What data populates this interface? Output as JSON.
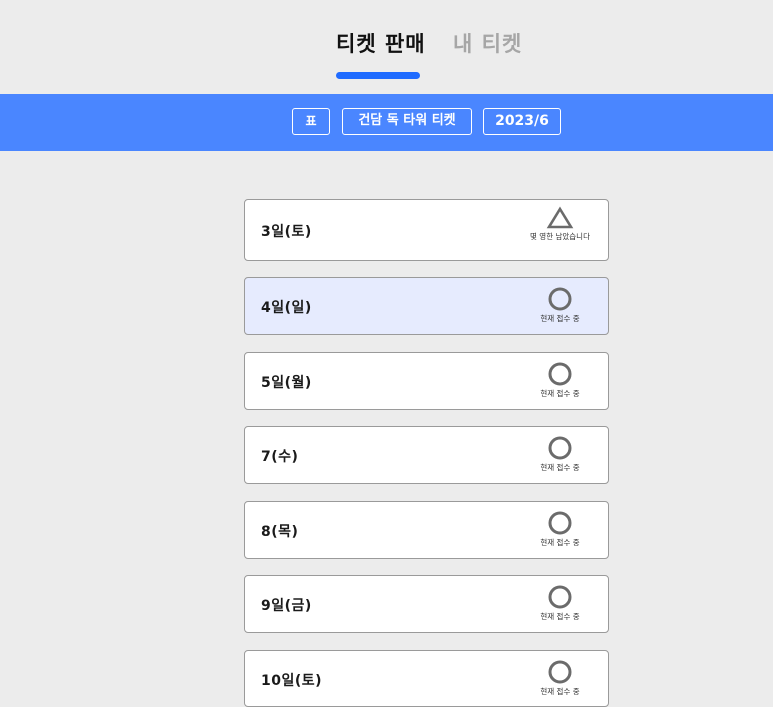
{
  "tabs": {
    "sell": "티켓 판매",
    "mine": "내 티켓"
  },
  "filters": {
    "type": "표",
    "event": "건담 독 타워 티켓",
    "month": "2023/6"
  },
  "accent_color": "#4a86ff",
  "underline_color": "#1f6bff",
  "dates": [
    {
      "label": "3일(토)",
      "status_icon": "triangle-icon",
      "status": "몇 영한 남았습니다"
    },
    {
      "label": "4일(일)",
      "status_icon": "circle-icon",
      "status": "현재 접수 중"
    },
    {
      "label": "5일(월)",
      "status_icon": "circle-icon",
      "status": "현재 접수 중"
    },
    {
      "label": "7(수)",
      "status_icon": "circle-icon",
      "status": "현재 접수 중"
    },
    {
      "label": "8(목)",
      "status_icon": "circle-icon",
      "status": "현재 접수 중"
    },
    {
      "label": "9일(금)",
      "status_icon": "circle-icon",
      "status": "현재 접수 중"
    },
    {
      "label": "10일(토)",
      "status_icon": "circle-icon",
      "status": "현재 접수 중"
    }
  ]
}
